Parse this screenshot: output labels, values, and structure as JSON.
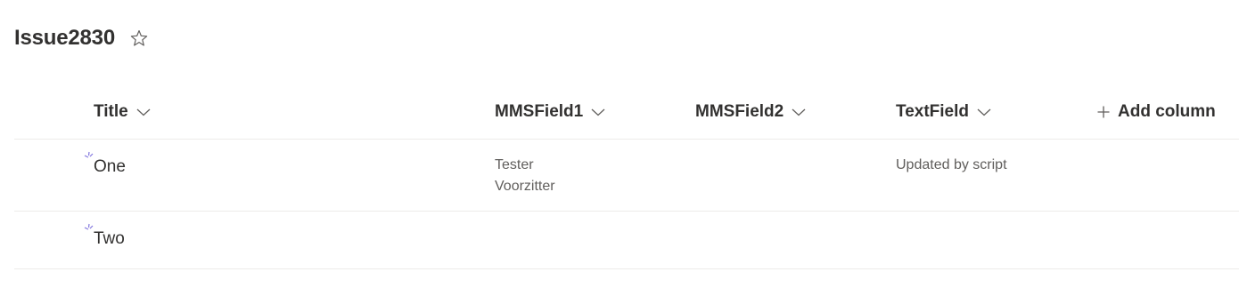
{
  "list": {
    "title": "Issue2830",
    "favorite_icon": "star-outline-icon"
  },
  "columns": [
    {
      "label": "Title"
    },
    {
      "label": "MMSField1"
    },
    {
      "label": "MMSField2"
    },
    {
      "label": "TextField"
    }
  ],
  "add_column": {
    "label": "Add column",
    "icon": "plus-icon"
  },
  "rows": [
    {
      "title": "One",
      "mmsfield1": [
        "Tester",
        "Voorzitter"
      ],
      "mmsfield2": "",
      "textfield": "Updated by script",
      "new_indicator_icon": "new-item-sparkle-icon"
    },
    {
      "title": "Two",
      "mmsfield1": [],
      "mmsfield2": "",
      "textfield": "",
      "new_indicator_icon": "new-item-sparkle-icon"
    }
  ],
  "colors": {
    "text_primary": "#323130",
    "text_secondary": "#605e5c",
    "divider": "#edebe9",
    "new_indicator": "#8378de"
  }
}
